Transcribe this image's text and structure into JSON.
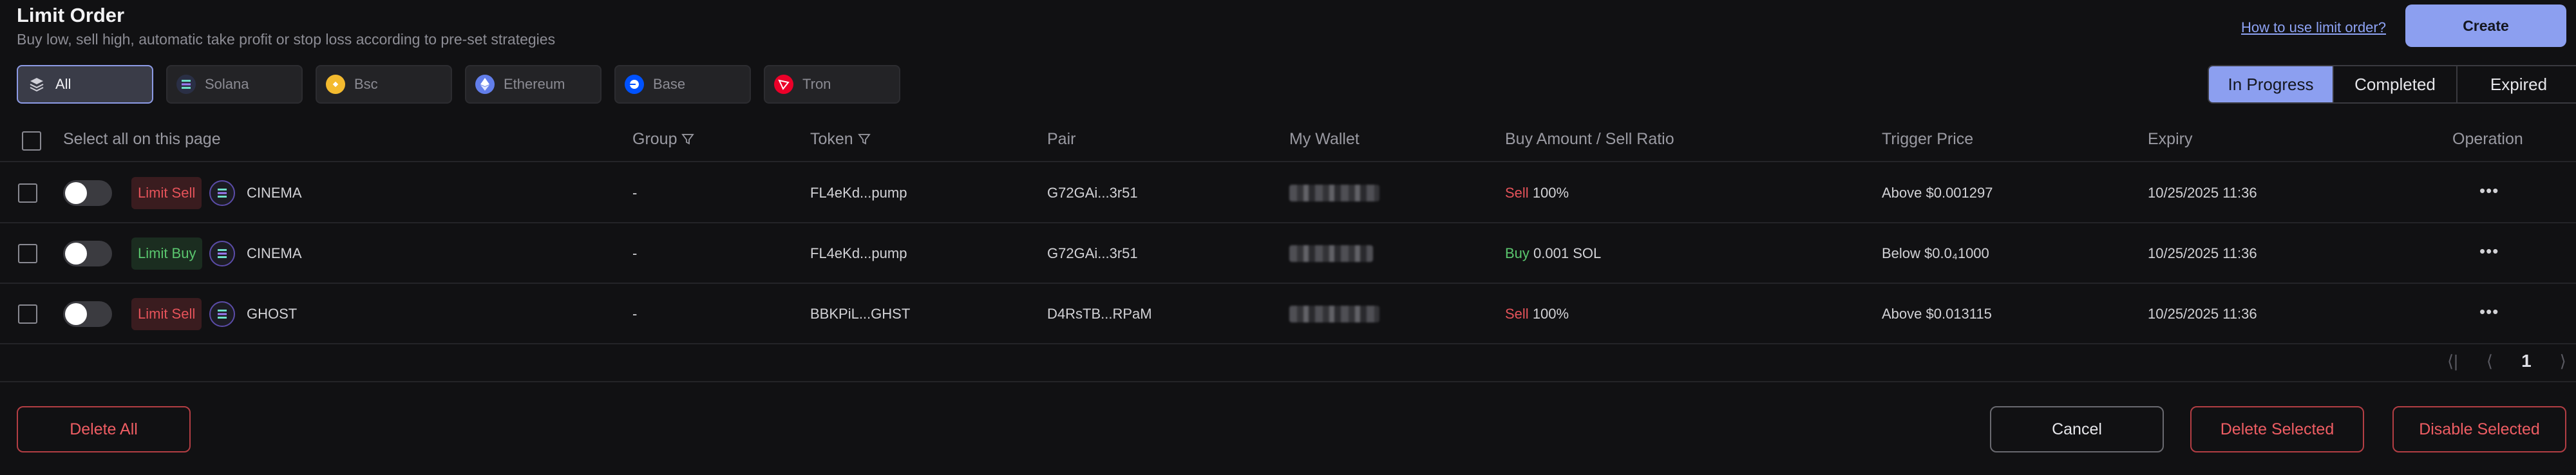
{
  "header": {
    "title": "Limit Order",
    "subtitle": "Buy low, sell high, automatic take profit or stop loss according to pre-set strategies",
    "help_link": "How to use limit order?",
    "create_label": "Create"
  },
  "chains": [
    {
      "label": "All",
      "icon": "layers-icon",
      "color": "#c8c8d0",
      "active": true
    },
    {
      "label": "Solana",
      "icon": "solana-icon",
      "color": "#2a2f45",
      "active": false
    },
    {
      "label": "Bsc",
      "icon": "bsc-icon",
      "color": "#f3ba2f",
      "active": false
    },
    {
      "label": "Ethereum",
      "icon": "ethereum-icon",
      "color": "#627eea",
      "active": false
    },
    {
      "label": "Base",
      "icon": "base-icon",
      "color": "#0052ff",
      "active": false
    },
    {
      "label": "Tron",
      "icon": "tron-icon",
      "color": "#eb0029",
      "active": false
    }
  ],
  "status_tabs": [
    {
      "label": "In Progress",
      "active": true
    },
    {
      "label": "Completed",
      "active": false
    },
    {
      "label": "Expired",
      "active": false
    }
  ],
  "table": {
    "select_all_label": "Select all on this page",
    "columns": {
      "group": "Group",
      "token": "Token",
      "pair": "Pair",
      "wallet": "My Wallet",
      "amount": "Buy Amount / Sell Ratio",
      "trigger": "Trigger Price",
      "expiry": "Expiry",
      "operation": "Operation"
    },
    "rows": [
      {
        "type": "Limit Sell",
        "token_name": "CINEMA",
        "group": "-",
        "token": "FL4eKd...pump",
        "pair": "G72GAi...3r51",
        "side": "Sell",
        "amount": "100%",
        "trigger": "Above $0.001297",
        "expiry": "10/25/2025 11:36",
        "op": "•••"
      },
      {
        "type": "Limit Buy",
        "token_name": "CINEMA",
        "group": "-",
        "token": "FL4eKd...pump",
        "pair": "G72GAi...3r51",
        "side": "Buy",
        "amount": "0.001 SOL",
        "trigger": "Below $0.0₄1000",
        "expiry": "10/25/2025 11:36",
        "op": "•••"
      },
      {
        "type": "Limit Sell",
        "token_name": "GHOST",
        "group": "-",
        "token": "BBKPiL...GHST",
        "pair": "D4RsTB...RPaM",
        "side": "Sell",
        "amount": "100%",
        "trigger": "Above $0.013115",
        "expiry": "10/25/2025 11:36",
        "op": "•••"
      }
    ]
  },
  "pagination": {
    "first": "⟨|",
    "prev": "⟨",
    "page": "1",
    "next": "⟩"
  },
  "footer": {
    "delete_all": "Delete All",
    "cancel": "Cancel",
    "delete_selected": "Delete Selected",
    "disable_selected": "Disable Selected"
  }
}
